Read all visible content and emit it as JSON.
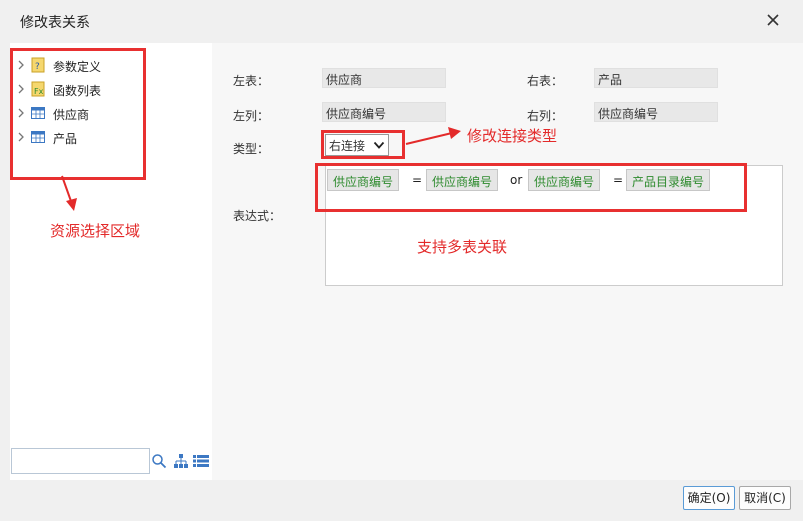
{
  "dialog": {
    "title": "修改表关系"
  },
  "tree": {
    "items": [
      {
        "label": "参数定义",
        "icon": "parameter-icon"
      },
      {
        "label": "函数列表",
        "icon": "function-icon"
      },
      {
        "label": "供应商",
        "icon": "table-icon"
      },
      {
        "label": "产品",
        "icon": "table-icon"
      }
    ],
    "search_value": ""
  },
  "relation": {
    "left_table_label": "左表：",
    "left_table_value": "供应商",
    "right_table_label": "右表：",
    "right_table_value": "产品",
    "left_column_label": "左列：",
    "left_column_value": "供应商编号",
    "right_column_label": "右列：",
    "right_column_value": "供应商编号",
    "type_label": "类型：",
    "type_value": "右连接",
    "expression_label": "表达式："
  },
  "expression": {
    "chip1": "供应商编号",
    "op1": "=",
    "chip2": "供应商编号",
    "op2": "or",
    "chip3": "供应商编号",
    "op3": "=",
    "chip4": "产品目录编号"
  },
  "annotations": {
    "resource_area": "资源选择区域",
    "modify_join_type": "修改连接类型",
    "multi_table": "支持多表关联"
  },
  "footer": {
    "ok_label": "确定(O)",
    "cancel_label": "取消(C)"
  },
  "colors": {
    "annotation_red": "#e32a2a",
    "chip_text_green": "#2e8b2e"
  }
}
